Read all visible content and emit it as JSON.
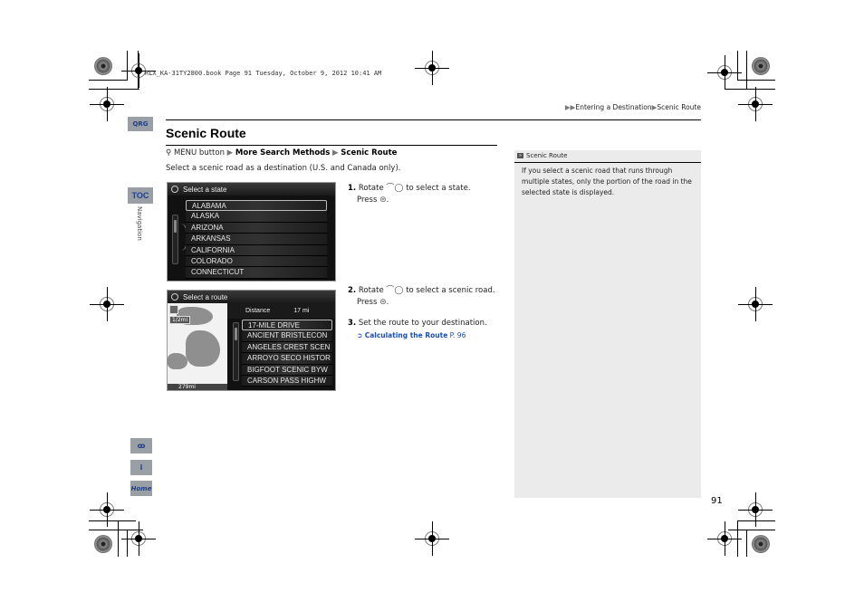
{
  "print_meta": "RLX_KA-31TY2800.book  Page 91  Tuesday, October 9, 2012  10:41 AM",
  "breadcrumb": {
    "prefix": "▶▶",
    "section": "Entering a Destination",
    "separator": "▶",
    "current": "Scenic Route"
  },
  "side_tabs": {
    "qrg": "QRG",
    "toc": "TOC",
    "chapter": "Navigation"
  },
  "page": {
    "title": "Scenic Route",
    "menu_path": {
      "icon": "menu-button-icon",
      "start": "MENU button",
      "arrow": "▶",
      "step1": "More Search Methods",
      "step2": "Scenic Route"
    },
    "intro": "Select a scenic road as a destination (U.S. and Canada only)."
  },
  "screen_state": {
    "header": "Select a state",
    "items": [
      "ALABAMA",
      "ALASKA",
      "ARIZONA",
      "ARKANSAS",
      "CALIFORNIA",
      "COLORADO",
      "CONNECTICUT"
    ],
    "selected_index": 0
  },
  "screen_route": {
    "header": "Select a route",
    "distance_label": "Distance",
    "distance_value": "17 mi",
    "map_scale": "1/2mi",
    "map_bottom": "279mi",
    "items": [
      "17-MILE DRIVE",
      "ANCIENT BRISTLECON",
      "ANGELES CREST SCEN",
      "ARROYO SECO HISTOR",
      "BIGFOOT SCENIC BYW",
      "CARSON PASS HIGHW"
    ],
    "selected_index": 0
  },
  "steps": [
    {
      "num": "1.",
      "rotate": "Rotate",
      "rotate_after": "to select a state.",
      "press": "Press"
    },
    {
      "num": "2.",
      "rotate": "Rotate",
      "rotate_after": "to select a scenic road.",
      "press": "Press"
    },
    {
      "num": "3.",
      "text": "Set the route to your destination.",
      "link_text": "Calculating the Route",
      "link_page": "P. 96"
    }
  ],
  "note": {
    "title": "Scenic Route",
    "body": "If you select a scenic road that runs through multiple states, only the portion of the road in the selected state is displayed."
  },
  "page_number": "91",
  "bottom_icons": [
    "voice-command-icon",
    "info-icon",
    "home-icon"
  ],
  "bottom_labels": {
    "home": "Home"
  },
  "colors": {
    "link": "#1c4fb0",
    "tab_bg": "#9a9fa6",
    "tab_text": "#1c3f8c",
    "note_bg": "#ebebeb"
  }
}
